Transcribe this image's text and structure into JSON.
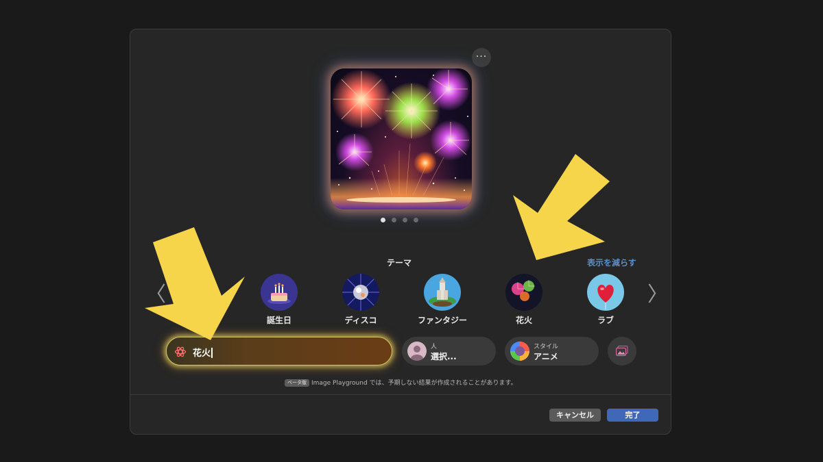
{
  "preview": {
    "more_label": "···",
    "page_count": 4,
    "active_page": 1
  },
  "themes": {
    "heading": "テーマ",
    "show_less": "表示を減らす",
    "prev": "〈",
    "next": "〉",
    "items": [
      {
        "label": "誕生日",
        "icon": "birthday-cake-icon"
      },
      {
        "label": "ディスコ",
        "icon": "disco-ball-icon"
      },
      {
        "label": "ファンタジー",
        "icon": "fantasy-castle-icon"
      },
      {
        "label": "花火",
        "icon": "fireworks-icon"
      },
      {
        "label": "ラブ",
        "icon": "heart-icon"
      }
    ]
  },
  "prompt": {
    "value": "花火",
    "icon": "image-playground-icon"
  },
  "person_chip": {
    "small": "人",
    "big": "選択..."
  },
  "style_chip": {
    "small": "スタイル",
    "big": "アニメ"
  },
  "photo_chip": {
    "icon": "photo-icon"
  },
  "beta_notice": {
    "badge": "ベータ版",
    "text": "Image Playground では、予期しない結果が作成されることがあります。"
  },
  "buttons": {
    "cancel": "キャンセル",
    "done": "完了"
  },
  "colors": {
    "dialog_bg": "#262626",
    "accent": "#3f69b8",
    "link": "#5b8ec9",
    "annotation": "#f7d54a"
  }
}
